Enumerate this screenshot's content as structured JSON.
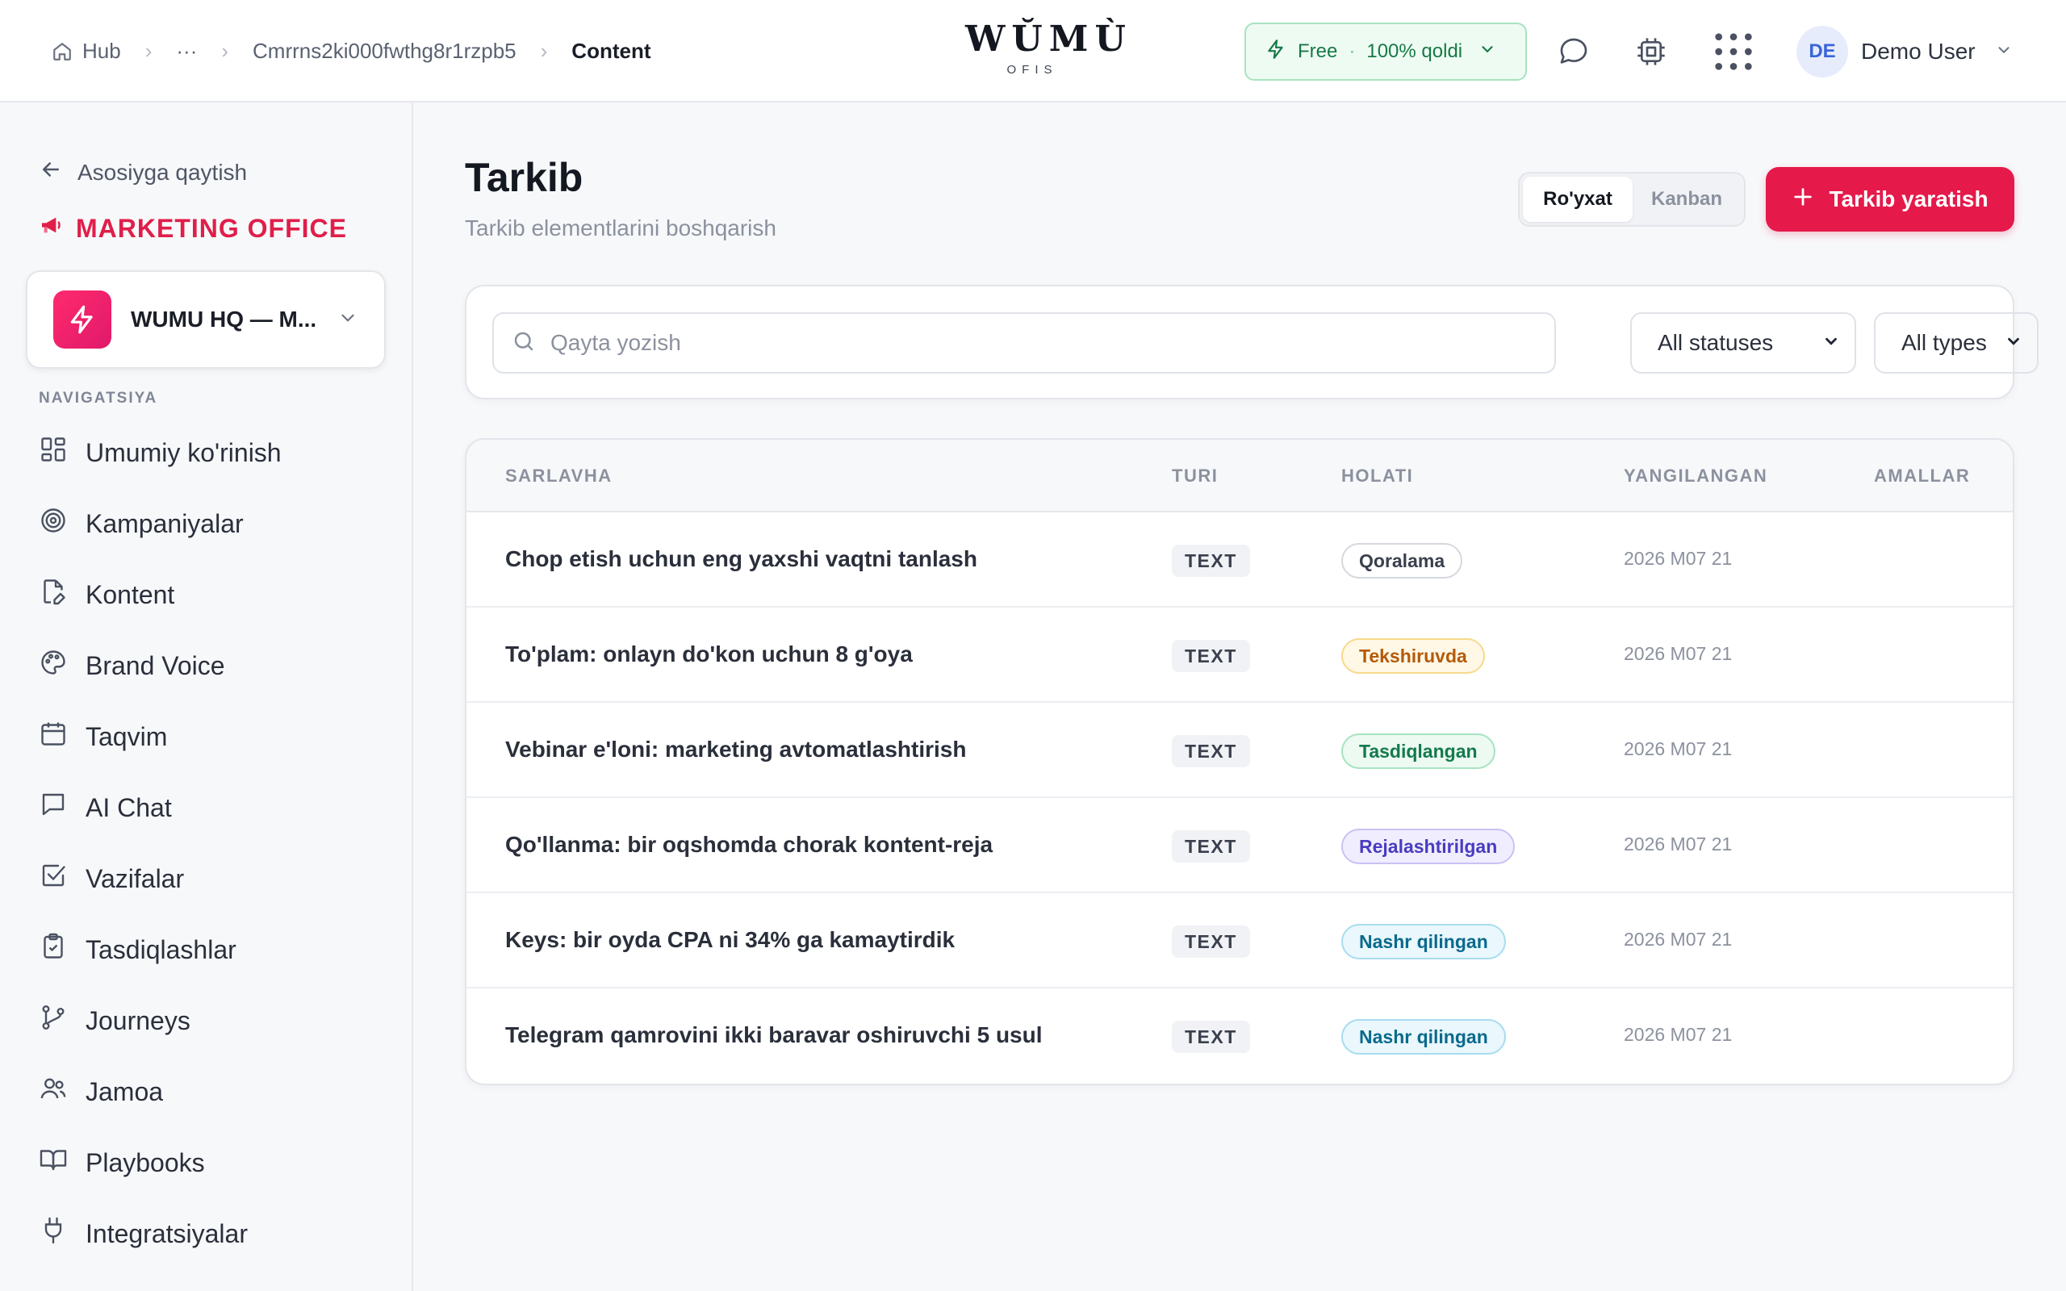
{
  "breadcrumbs": {
    "home": "Hub",
    "ellipsis": "···",
    "workspace_id": "Cmrrns2ki000fwthg8r1rzpb5",
    "current": "Content"
  },
  "logo": {
    "main": "WŬMÙ",
    "sub": "OFIS"
  },
  "plan": {
    "name": "Free",
    "separator": "·",
    "remaining": "100% qoldi"
  },
  "user": {
    "initials": "DE",
    "name": "Demo User"
  },
  "sidebar": {
    "back_label": "Asosiyga qaytish",
    "office_title": "MARKETING OFFICE",
    "workspace_name": "WUMU HQ — M...",
    "nav_heading": "NAVIGATSIYA",
    "items": [
      {
        "label": "Umumiy ko'rinish",
        "icon": "dashboard-icon"
      },
      {
        "label": "Kampaniyalar",
        "icon": "target-icon"
      },
      {
        "label": "Kontent",
        "icon": "file-edit-icon"
      },
      {
        "label": "Brand Voice",
        "icon": "palette-icon"
      },
      {
        "label": "Taqvim",
        "icon": "calendar-icon"
      },
      {
        "label": "AI Chat",
        "icon": "chat-icon"
      },
      {
        "label": "Vazifalar",
        "icon": "checkbox-icon"
      },
      {
        "label": "Tasdiqlashlar",
        "icon": "clipboard-check-icon"
      },
      {
        "label": "Journeys",
        "icon": "git-branch-icon"
      },
      {
        "label": "Jamoa",
        "icon": "users-icon"
      },
      {
        "label": "Playbooks",
        "icon": "book-open-icon"
      },
      {
        "label": "Integratsiyalar",
        "icon": "plug-icon"
      }
    ]
  },
  "main": {
    "title": "Tarkib",
    "subtitle": "Tarkib elementlarini boshqarish",
    "view_list": "Ro'yxat",
    "view_kanban": "Kanban",
    "create_label": "Tarkib yaratish",
    "search_placeholder": "Qayta yozish",
    "status_filter": "All statuses",
    "type_filter": "All types"
  },
  "table": {
    "headers": {
      "title": "SARLAVHA",
      "type": "TURI",
      "status": "HOLATI",
      "updated": "YANGILANGAN",
      "actions": "AMALLAR"
    },
    "rows": [
      {
        "title": "Chop etish uchun eng yaxshi vaqtni tanlash",
        "type": "TEXT",
        "status": "Qoralama",
        "status_color": "#3a404d",
        "status_bg": "#ffffff",
        "status_border": "#d5d8de",
        "updated": "2026 M07 21"
      },
      {
        "title": "To'plam: onlayn do'kon uchun 8 g'oya",
        "type": "TEXT",
        "status": "Tekshiruvda",
        "status_color": "#b45a08",
        "status_bg": "#fff8e6",
        "status_border": "#f7d98b",
        "updated": "2026 M07 21"
      },
      {
        "title": "Vebinar e'loni: marketing avtomatlashtirish",
        "type": "TEXT",
        "status": "Tasdiqlangan",
        "status_color": "#137a4b",
        "status_bg": "#ecfaf2",
        "status_border": "#a7e3c0",
        "updated": "2026 M07 21"
      },
      {
        "title": "Qo'llanma: bir oqshomda chorak kontent-reja",
        "type": "TEXT",
        "status": "Rejalashtirilgan",
        "status_color": "#4a3cc0",
        "status_bg": "#f0eefe",
        "status_border": "#c9c2f5",
        "updated": "2026 M07 21"
      },
      {
        "title": "Keys: bir oyda CPA ni 34% ga kamaytirdik",
        "type": "TEXT",
        "status": "Nashr qilingan",
        "status_color": "#0a6a8c",
        "status_bg": "#eaf7fc",
        "status_border": "#a8dcef",
        "updated": "2026 M07 21"
      },
      {
        "title": "Telegram qamrovini ikki baravar oshiruvchi 5 usul",
        "type": "TEXT",
        "status": "Nashr qilingan",
        "status_color": "#0a6a8c",
        "status_bg": "#eaf7fc",
        "status_border": "#a8dcef",
        "updated": "2026 M07 21"
      }
    ]
  }
}
